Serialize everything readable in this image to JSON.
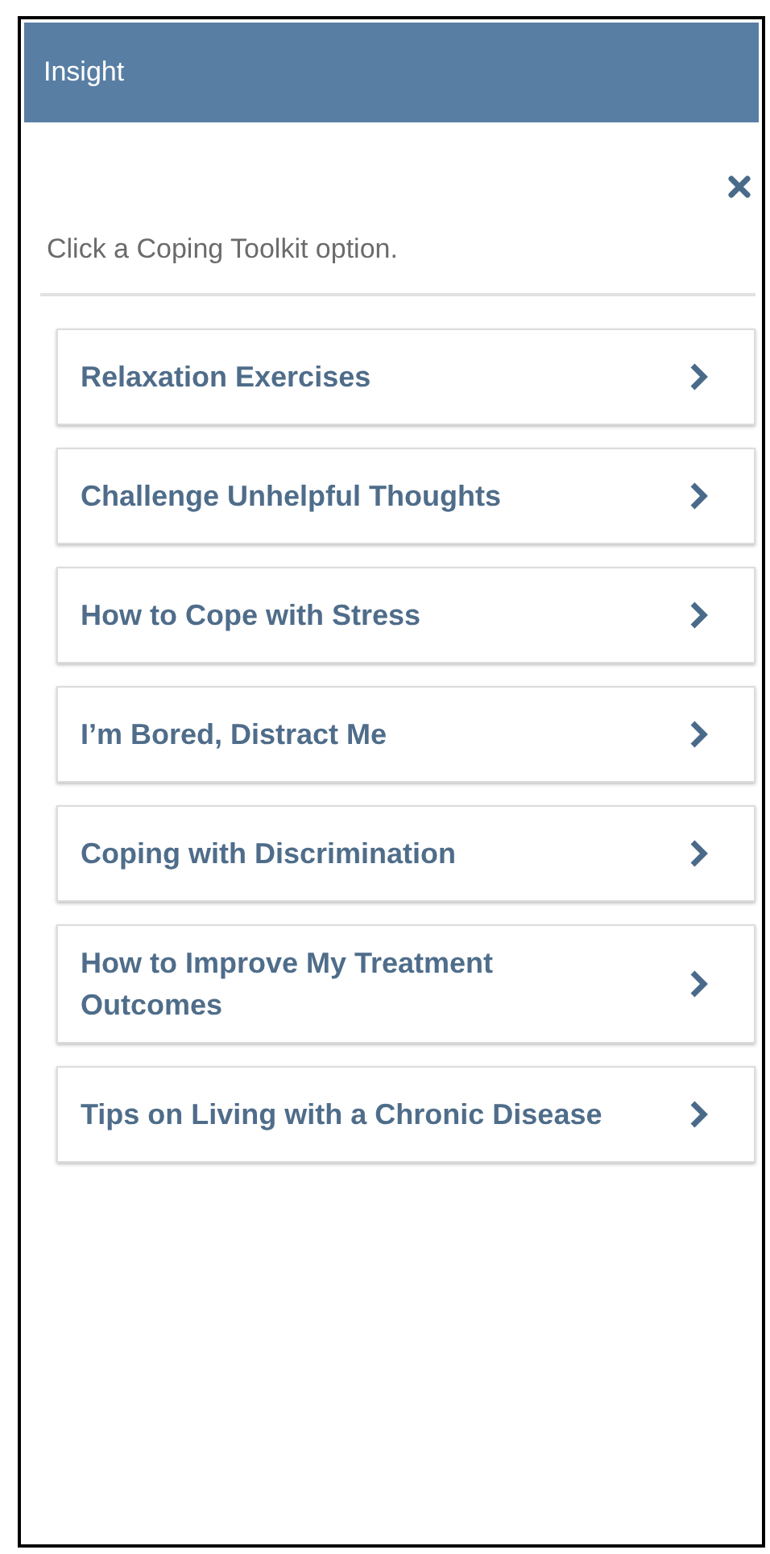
{
  "header": {
    "title": "Insight"
  },
  "instruction": "Click a Coping Toolkit option.",
  "options": [
    {
      "label": "Relaxation Exercises"
    },
    {
      "label": "Challenge Unhelpful Thoughts"
    },
    {
      "label": "How to Cope with Stress"
    },
    {
      "label": "I’m Bored, Distract Me"
    },
    {
      "label": "Coping with Discrimination"
    },
    {
      "label": "How to Improve My Treatment Outcomes"
    },
    {
      "label": "Tips on Living with a Chronic Disease"
    }
  ]
}
